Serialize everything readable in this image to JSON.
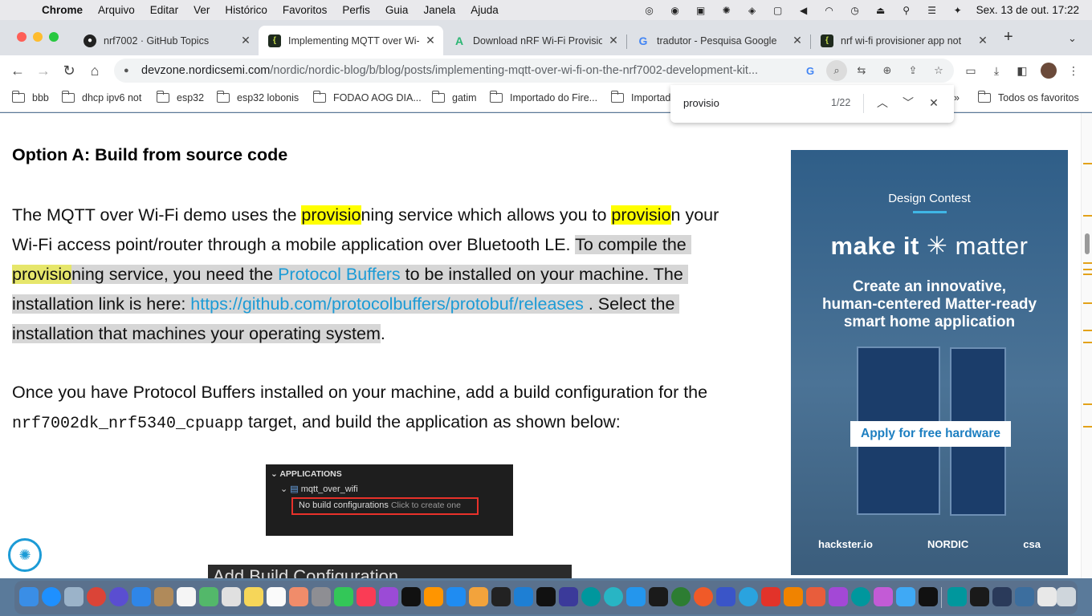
{
  "menubar": {
    "app_name": "Chrome",
    "items": [
      "Arquivo",
      "Editar",
      "Ver",
      "Histórico",
      "Favoritos",
      "Perfis",
      "Guia",
      "Janela",
      "Ajuda"
    ],
    "clock": "Sex. 13 de out.  17:22"
  },
  "tabs": [
    {
      "title": "nrf7002 · GitHub Topics",
      "favicon": "github-icon",
      "fav_glyph": "●"
    },
    {
      "title": "Implementing MQTT over Wi-Fi",
      "favicon": "devzone-icon",
      "fav_glyph": "{"
    },
    {
      "title": "Download nRF Wi-Fi Provisioner",
      "favicon": "android-icon",
      "fav_glyph": "A"
    },
    {
      "title": "tradutor - Pesquisa Google",
      "favicon": "google-icon",
      "fav_glyph": "G"
    },
    {
      "title": "nrf wi-fi provisioner app not",
      "favicon": "devzone-icon",
      "fav_glyph": "{"
    }
  ],
  "omnibox": {
    "host": "devzone.nordicsemi.com",
    "path": "/nordic/nordic-blog/b/blog/posts/implementing-mqtt-over-wi-fi-on-the-nrf7002-development-kit..."
  },
  "bookmarks": [
    "bbb",
    "dhcp ipv6 not",
    "esp32",
    "esp32 lobonis",
    "FODAO  AOG DIA...",
    "gatim",
    "Importado do Fire...",
    "Importad"
  ],
  "bookmarks_overflow": "»",
  "bookmarks_all": "Todos os favoritos",
  "findbar": {
    "query": "provisio",
    "count": "1/22"
  },
  "article": {
    "heading": "Option A: Build from source code",
    "p1": {
      "a": "The MQTT over Wi-Fi demo uses the ",
      "hl1": "provisio",
      "b": "ning service which allows you to ",
      "hl2": "provisio",
      "c": "n your",
      "d": "Wi-Fi access point/router through a mobile application over Bluetooth LE. ",
      "e": "To compile the",
      "hl3": "provisio",
      "f": "ning service, you need the ",
      "link1": "Protocol Buffers",
      "g": " to be installed on your machine. The",
      "h": "installation link is here: ",
      "link2": "https://github.com/protocolbuffers/protobuf/releases",
      "i": " . Select the",
      "j": "installation that machines your operating system",
      "k": "."
    },
    "p2": {
      "a": "Once you have Protocol Buffers installed on your machine, add a build configuration for the",
      "code": "nrf7002dk_nrf5340_cpuapp",
      "b": " target, and build the application as shown below:"
    },
    "vs": {
      "section": "APPLICATIONS",
      "project": "mqtt_over_wifi",
      "nobuild": "No build configurations",
      "create": "Click to create one"
    },
    "add_build": "Add Build Configuration"
  },
  "ad": {
    "contest": "Design Contest",
    "brand_a": "make it",
    "brand_b": "matter",
    "tag1": "Create an innovative,",
    "tag2": "human-centered Matter-ready",
    "tag3": "smart home application",
    "cta": "Apply for free hardware",
    "logo1": "hackster.io",
    "logo2": "NORDIC",
    "logo3": "csa"
  },
  "colors": {
    "highlight": "#ffff00",
    "selection": "#d6d6d6",
    "link": "#1c9bd6"
  }
}
